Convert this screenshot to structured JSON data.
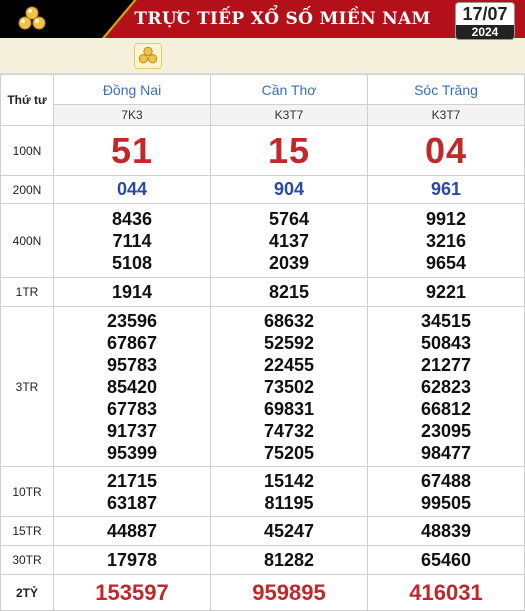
{
  "header": {
    "title": "TRỰC TIẾP XỔ SỐ MIỀN NAM",
    "date_day": "17/07",
    "date_year": "2024",
    "logo_icon": "lottery-balls-icon",
    "accent_color": "#b3101a"
  },
  "table": {
    "day_label": "Thứ tư",
    "provinces": [
      {
        "name": "Đồng Nai",
        "code": "7K3"
      },
      {
        "name": "Cần Thơ",
        "code": "K3T7"
      },
      {
        "name": "Sóc Trăng",
        "code": "K3T7"
      }
    ],
    "prizes": [
      {
        "label": "100N",
        "values": [
          [
            "51"
          ],
          [
            "15"
          ],
          [
            "04"
          ]
        ]
      },
      {
        "label": "200N",
        "values": [
          [
            "044"
          ],
          [
            "904"
          ],
          [
            "961"
          ]
        ]
      },
      {
        "label": "400N",
        "values": [
          [
            "8436",
            "7114",
            "5108"
          ],
          [
            "5764",
            "4137",
            "2039"
          ],
          [
            "9912",
            "3216",
            "9654"
          ]
        ]
      },
      {
        "label": "1TR",
        "values": [
          [
            "1914"
          ],
          [
            "8215"
          ],
          [
            "9221"
          ]
        ]
      },
      {
        "label": "3TR",
        "values": [
          [
            "23596",
            "67867",
            "95783",
            "85420",
            "67783",
            "91737",
            "95399"
          ],
          [
            "68632",
            "52592",
            "22455",
            "73502",
            "69831",
            "74732",
            "75205"
          ],
          [
            "34515",
            "50843",
            "21277",
            "62823",
            "66812",
            "23095",
            "98477"
          ]
        ]
      },
      {
        "label": "10TR",
        "values": [
          [
            "21715",
            "63187"
          ],
          [
            "15142",
            "81195"
          ],
          [
            "67488",
            "99505"
          ]
        ]
      },
      {
        "label": "15TR",
        "values": [
          [
            "44887"
          ],
          [
            "45247"
          ],
          [
            "48839"
          ]
        ]
      },
      {
        "label": "30TR",
        "values": [
          [
            "17978"
          ],
          [
            "81282"
          ],
          [
            "65460"
          ]
        ]
      },
      {
        "label": "2TỶ",
        "values": [
          [
            "153597"
          ],
          [
            "959895"
          ],
          [
            "416031"
          ]
        ]
      }
    ]
  }
}
